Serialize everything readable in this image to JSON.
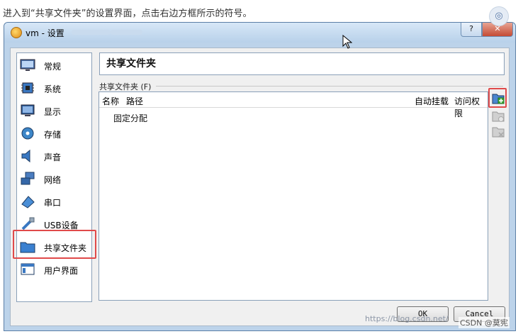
{
  "caption": "进入到“共享文件夹”的设置界面，点击右边方框所示的符号。",
  "window": {
    "title": "vm - 设置",
    "help_label": "?",
    "close_label": "✕"
  },
  "sidebar": {
    "items": [
      {
        "label": "常规",
        "icon": "monitor-icon"
      },
      {
        "label": "系统",
        "icon": "chip-icon"
      },
      {
        "label": "显示",
        "icon": "display-icon"
      },
      {
        "label": "存储",
        "icon": "disk-icon"
      },
      {
        "label": "声音",
        "icon": "speaker-icon"
      },
      {
        "label": "网络",
        "icon": "network-icon"
      },
      {
        "label": "串口",
        "icon": "serial-port-icon"
      },
      {
        "label": "USB设备",
        "icon": "usb-icon"
      },
      {
        "label": "共享文件夹",
        "icon": "folder-icon",
        "selected": true
      },
      {
        "label": "用户界面",
        "icon": "ui-icon"
      }
    ]
  },
  "main": {
    "title": "共享文件夹",
    "group_label": "共享文件夹 (F)",
    "columns": {
      "name": "名称",
      "path": "路径",
      "automount": "自动挂载",
      "access": "访问权限"
    },
    "rows": [
      "固定分配"
    ],
    "tools": [
      "add-shared-folder-icon",
      "edit-shared-folder-icon",
      "remove-shared-folder-icon"
    ]
  },
  "buttons": {
    "ok": "OK",
    "cancel": "Cancel"
  },
  "watermark": {
    "url": "https://blog.csdn.net/",
    "brand": "CSDN @莫宪"
  },
  "colors": {
    "highlight": "#e04a4a",
    "title_bar": "#b8d1ea"
  }
}
